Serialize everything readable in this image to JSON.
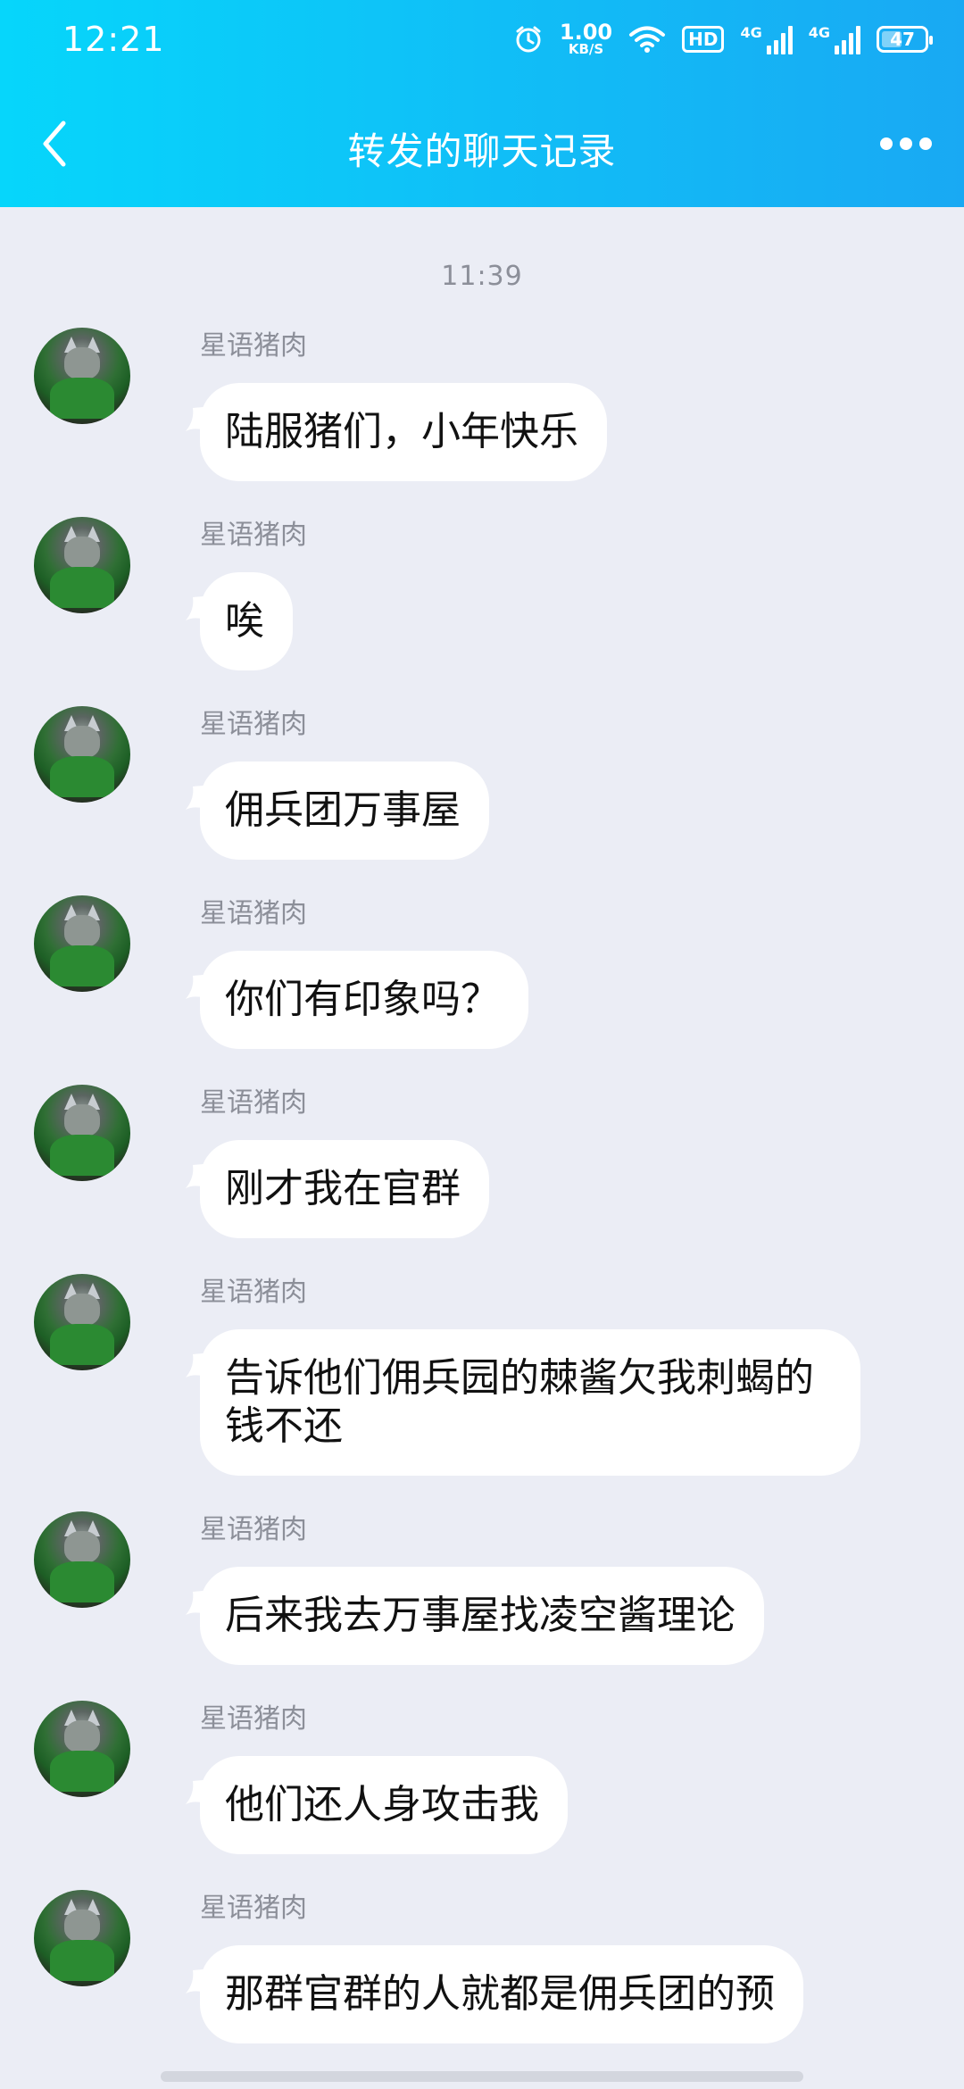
{
  "status_bar": {
    "time": "12:21",
    "net_speed_value": "1.00",
    "net_speed_unit": "KB/S",
    "hd_label": "HD",
    "signal_1_label": "4G",
    "signal_2_label": "4G",
    "battery_percent": "47",
    "battery_level": 0.47,
    "icons": [
      "alarm-icon",
      "wifi-icon",
      "hd-icon",
      "signal-icon",
      "signal-icon",
      "battery-icon"
    ]
  },
  "header": {
    "title": "转发的聊天记录",
    "back_icon": "chevron-left-icon",
    "more_icon": "more-dots-icon",
    "gradient": [
      "#06d6fb",
      "#19a9f3"
    ]
  },
  "chat": {
    "timestamp": "11:39",
    "messages": [
      {
        "sender": "星语猪肉",
        "text": "陆服猪们，小年快乐"
      },
      {
        "sender": "星语猪肉",
        "text": "唉"
      },
      {
        "sender": "星语猪肉",
        "text": "佣兵团万事屋"
      },
      {
        "sender": "星语猪肉",
        "text": "你们有印象吗？"
      },
      {
        "sender": "星语猪肉",
        "text": "刚才我在官群"
      },
      {
        "sender": "星语猪肉",
        "text": "告诉他们佣兵园的棘酱欠我刺蝎的钱不还"
      },
      {
        "sender": "星语猪肉",
        "text": "后来我去万事屋找凌空酱理论"
      },
      {
        "sender": "星语猪肉",
        "text": "他们还人身攻击我"
      },
      {
        "sender": "星语猪肉",
        "text": "那群官群的人就都是佣兵团的预"
      }
    ]
  },
  "colors": {
    "background": "#ebedf5",
    "bubble": "#ffffff",
    "meta_text": "#8c8f99"
  }
}
